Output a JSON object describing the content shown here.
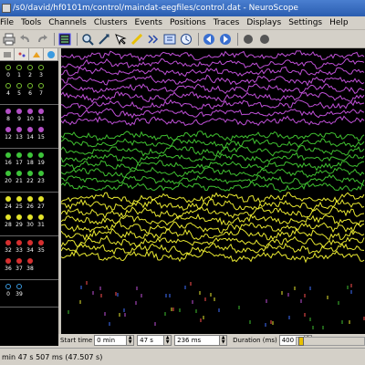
{
  "window": {
    "title": "/s0/david/hf0101m/control/maindat-eegfiles/control.dat - NeuroScope",
    "titlebar_color": "#3568c0"
  },
  "menu": [
    "File",
    "Tools",
    "Channels",
    "Clusters",
    "Events",
    "Positions",
    "Traces",
    "Displays",
    "Settings",
    "Help"
  ],
  "toolbar": {
    "icons": [
      "open-icon",
      "print-icon",
      "undo-icon",
      "redo-icon",
      "select-channels-icon",
      "zoom-icon",
      "measure-icon",
      "select-time-icon",
      "draw-time-line-icon",
      "select-events-icon",
      "add-event-icon",
      "ruler-icon",
      "previous-icon",
      "next-icon",
      "record-icon",
      "stop-icon"
    ]
  },
  "left_panel": {
    "tabs": [
      "channels-tab",
      "clusters-tab",
      "positions-tab",
      "events-tab"
    ],
    "groups": [
      {
        "color": "#22bb22",
        "rows": [
          [
            "0",
            "1",
            "2",
            "3"
          ],
          [
            "4",
            "5",
            "6",
            "7"
          ]
        ],
        "dot": "#7ac231",
        "hollow": true
      },
      {
        "color": "#bb44bb",
        "rows": [
          [
            "8",
            "9",
            "10",
            "11"
          ],
          [
            "12",
            "13",
            "14",
            "15"
          ]
        ],
        "dot": "#b24fc4"
      },
      {
        "color": "#22cc22",
        "rows": [
          [
            "16",
            "17",
            "18",
            "19"
          ],
          [
            "20",
            "21",
            "22",
            "23"
          ]
        ],
        "dot": "#3ec43a"
      },
      {
        "color": "#dddd22",
        "rows": [
          [
            "24",
            "25",
            "26",
            "27"
          ],
          [
            "28",
            "29",
            "30",
            "31"
          ]
        ],
        "dot": "#e3e32a"
      },
      {
        "color": "#dd3333",
        "rows": [
          [
            "32",
            "33",
            "34",
            "35"
          ],
          [
            "36",
            "37",
            "38"
          ]
        ],
        "dot": "#d62f2f"
      },
      {
        "color": "#3399ff",
        "rows": [
          [
            "0",
            "39"
          ]
        ],
        "dot": "#3a9ae0"
      }
    ]
  },
  "controls": {
    "start_time_label": "Start time",
    "min_value": "0 min",
    "s_value": "47 s",
    "ms_value": "236 ms",
    "duration_label": "Duration (ms)",
    "duration_value": "400"
  },
  "status": {
    "text": "min 47 s 507 ms (47.507 s)"
  },
  "colors": {
    "purple_trace": "#c050d8",
    "green_trace": "#40c030",
    "yellow_trace": "#e8e830",
    "spike_blue": "#4070ff",
    "background": "#000000"
  }
}
